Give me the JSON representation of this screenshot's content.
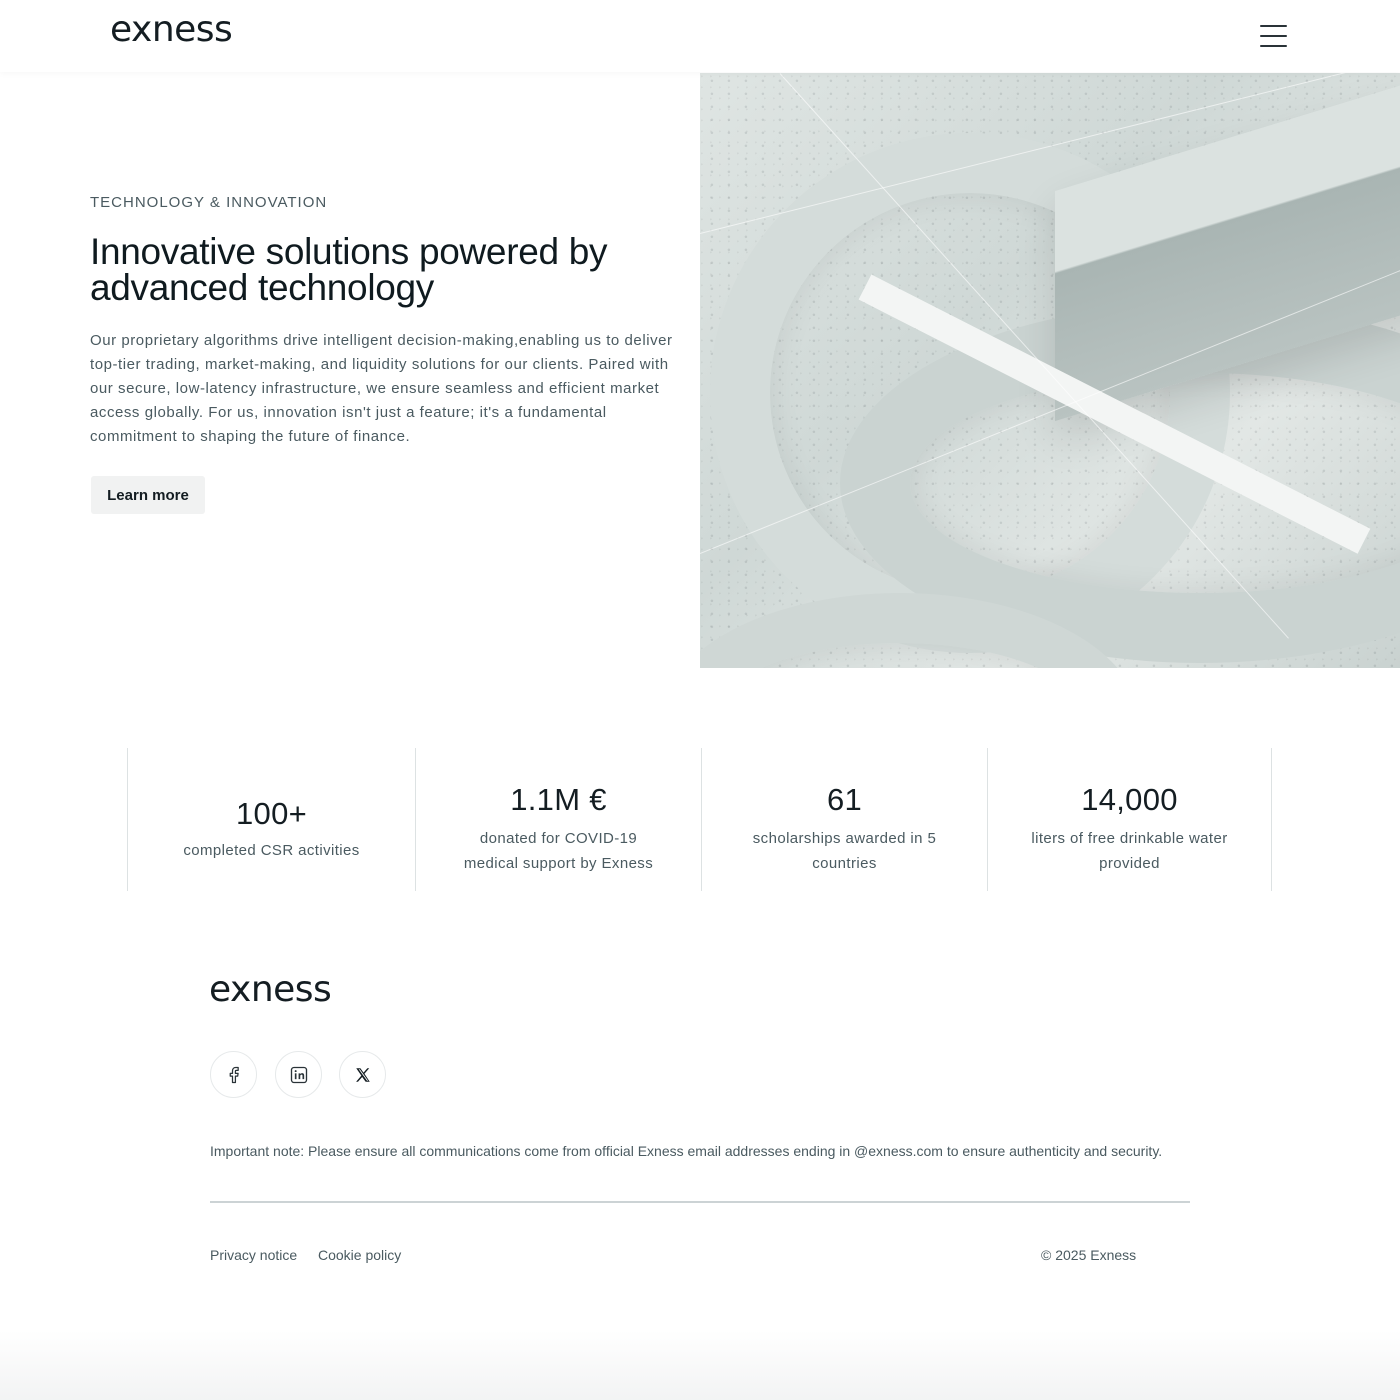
{
  "header": {
    "logo": "exness",
    "menu_icon": "hamburger-menu-icon"
  },
  "hero": {
    "eyebrow": "TECHNOLOGY & INNOVATION",
    "title": "Innovative solutions powered by advanced technology",
    "body": "Our proprietary algorithms drive intelligent decision-making,enabling us to deliver top-tier trading, market-making, and liquidity solutions for our clients. Paired with our secure, low-latency infrastructure, we ensure seamless and efficient market access globally. For us, innovation isn't just a feature; it's a fundamental commitment to shaping the future of finance.",
    "cta_label": "Learn more"
  },
  "stats": [
    {
      "value": "100+",
      "label": "completed CSR activities"
    },
    {
      "value": "1.1M €",
      "label": "donated for COVID-19 medical support by Exness"
    },
    {
      "value": "61",
      "label": "scholarships awarded in 5 countries"
    },
    {
      "value": "14,000",
      "label": "liters of free drinkable water provided"
    }
  ],
  "footer": {
    "logo": "exness",
    "social": [
      {
        "icon": "facebook-icon"
      },
      {
        "icon": "linkedin-icon"
      },
      {
        "icon": "x-twitter-icon"
      }
    ],
    "note": "Important note: Please ensure all communications come from official Exness email addresses ending in @exness.com to ensure authenticity and security.",
    "links": [
      "Privacy notice",
      "Cookie policy"
    ],
    "copyright": "© 2025 Exness"
  },
  "colors": {
    "text_primary": "#141d22",
    "text_secondary": "#4a5a60",
    "button_bg": "#f1f2f2",
    "divider": "#ccd3d5"
  }
}
